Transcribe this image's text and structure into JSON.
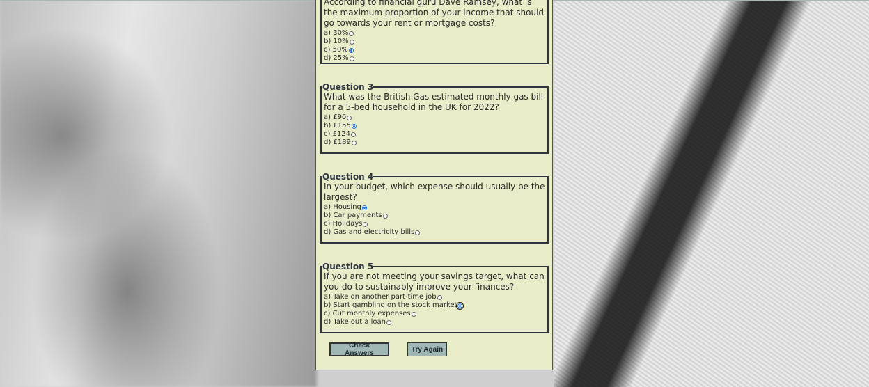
{
  "quiz": {
    "q2": {
      "text_partial": "According to financial guru Dave Ramsey, what is the",
      "text_rest": "maximum proportion of your income that should go towards your rent or mortgage costs?",
      "options": [
        "a) 30%",
        "b) 10%",
        "c) 50%",
        "d) 25%"
      ],
      "selected": 2
    },
    "q3": {
      "legend": "Question 3",
      "text": "What was the British Gas estimated monthly gas bill for a 5-bed household in the UK for 2022?",
      "options": [
        "a) £90",
        "b) £155",
        "c) £124",
        "d) £189"
      ],
      "selected": 1
    },
    "q4": {
      "legend": "Question 4",
      "text": "In your budget, which expense should usually be the largest?",
      "options": [
        "a) Housing",
        "b) Car payments",
        "c) Holidays",
        "d) Gas and electricity bills"
      ],
      "selected": 0
    },
    "q5": {
      "legend": "Question 5",
      "text": "If you are not meeting your savings target, what can you do to sustainably improve your finances?",
      "options": [
        "a) Take on another part-time job",
        "b) Start gambling on the stock market",
        "c) Cut monthly expenses",
        "d) Take out a loan"
      ],
      "selected": 1
    }
  },
  "buttons": {
    "check": "Check Answers",
    "retry": "Try Again"
  },
  "colors": {
    "panel_bg": "#e9ecc9",
    "button_bg": "#9fb7b5",
    "radio_checked": "#1a73e8"
  }
}
